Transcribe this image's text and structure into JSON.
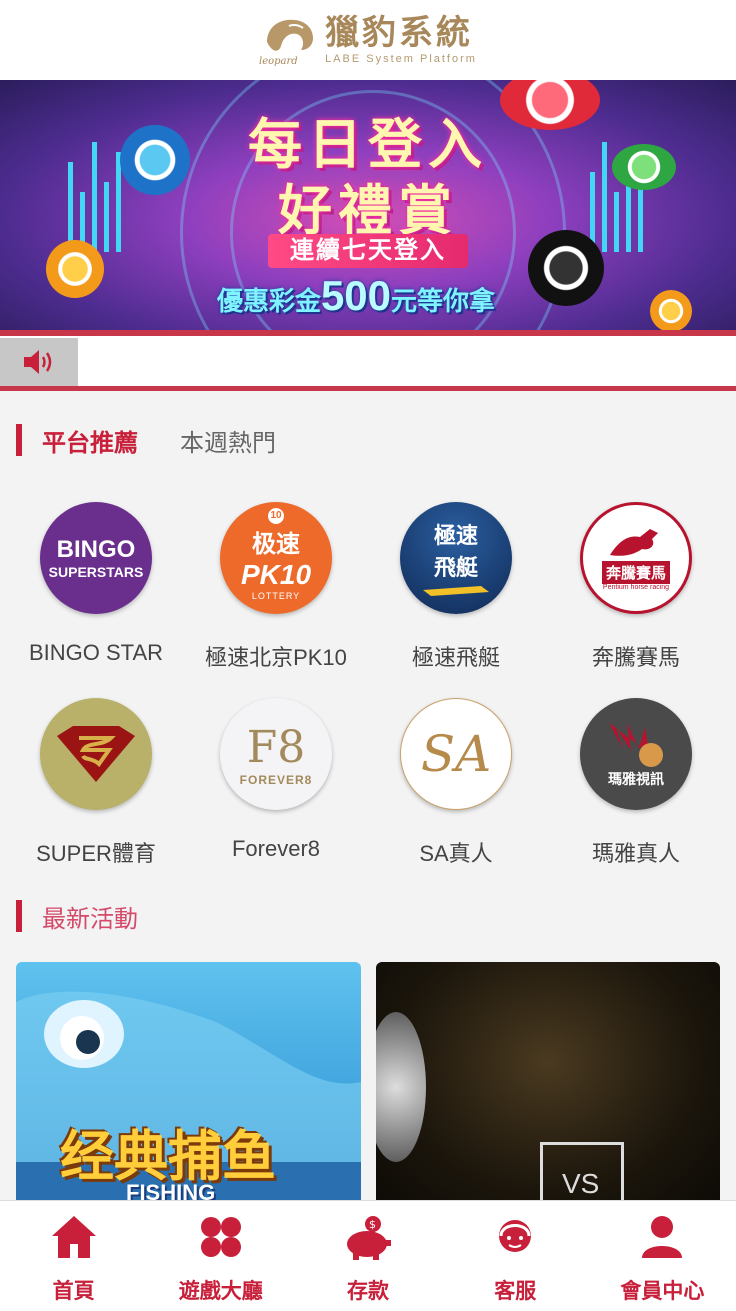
{
  "header": {
    "logo_cn": "獵豹系統",
    "logo_en": "LABE System Platform",
    "logo_mark": "leopard"
  },
  "banner": {
    "line1": "每日登入",
    "line2": "好禮賞",
    "sub": "連續七天登入",
    "promo_prefix": "優惠彩金",
    "promo_amount": "500",
    "promo_suffix": "元等你拿"
  },
  "marquee": {
    "icon": "speaker-icon",
    "text": ""
  },
  "platform_section": {
    "tab_active": "平台推薦",
    "tab_other": "本週熱門"
  },
  "platforms": [
    {
      "label": "BINGO STAR",
      "logo_line1": "BINGO",
      "logo_line2": "SUPERSTARS",
      "color": "#6a2e8c"
    },
    {
      "label": "極速北京PK10",
      "logo_line1": "极速",
      "logo_line2": "PK10",
      "logo_line3": "LOTTERY",
      "badge": "10",
      "color": "#ee6a2a"
    },
    {
      "label": "極速飛艇",
      "logo_line1": "極速",
      "logo_line2": "飛艇",
      "color": "#1a3f7a"
    },
    {
      "label": "奔騰賽馬",
      "logo_line1": "奔騰賽馬",
      "logo_line2": "Pentium horse racing",
      "color": "#b8132e"
    },
    {
      "label": "SUPER體育",
      "color": "#b9b16a"
    },
    {
      "label": "Forever8",
      "logo_line1": "F8",
      "logo_line2": "FOREVER8",
      "color": "#f4f4f6"
    },
    {
      "label": "SA真人",
      "logo_line1": "SA",
      "color": "#ffffff"
    },
    {
      "label": "瑪雅真人",
      "logo_line1": "瑪雅視訊",
      "color": "#4a4a4a"
    }
  ],
  "activities": {
    "title": "最新活動",
    "cards": [
      {
        "text": "经典捕鱼",
        "sub": "FISHING"
      },
      {
        "text": "VS"
      }
    ]
  },
  "bottom_nav": [
    {
      "label": "首頁",
      "icon": "home-icon"
    },
    {
      "label": "遊戲大廳",
      "icon": "game-lobby-icon"
    },
    {
      "label": "存款",
      "icon": "piggy-bank-icon"
    },
    {
      "label": "客服",
      "icon": "customer-service-icon"
    },
    {
      "label": "會員中心",
      "icon": "member-icon"
    }
  ],
  "colors": {
    "accent": "#c8203a",
    "gold": "#a8885a",
    "background": "#f3f3f3"
  }
}
